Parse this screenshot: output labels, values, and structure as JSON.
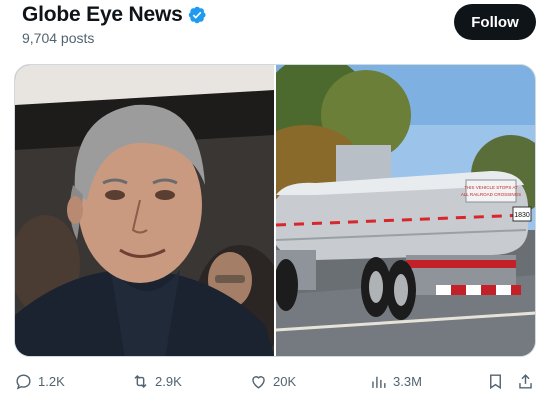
{
  "header": {
    "display_name": "Globe Eye News",
    "posts_count": "9,704 posts",
    "follow_label": "Follow"
  },
  "media": {
    "left_image": "photo-of-man-in-dark-jacket",
    "right_image": "photo-of-tanker-truck-on-road",
    "tank_sign": "THIS VEHICLE STOPS AT ALL RAILROAD CROSSINGS",
    "placard": "1830"
  },
  "actions": {
    "reply_count": "1.2K",
    "repost_count": "2.9K",
    "like_count": "20K",
    "views_count": "3.3M"
  },
  "colors": {
    "follow_bg": "#0f1419",
    "verified": "#1d9bf0",
    "muted_text": "#536471"
  }
}
